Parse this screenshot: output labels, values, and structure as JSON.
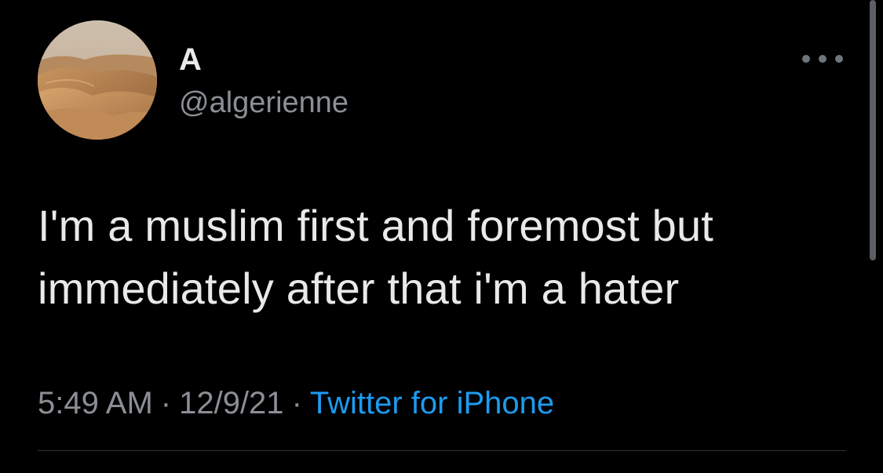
{
  "tweet": {
    "display_name": "A",
    "handle": "@algerienne",
    "text_line1": "I'm a muslim first and foremost but",
    "text_line2": "immediately after that i'm a hater",
    "time": "5:49 AM",
    "date": "12/9/21",
    "source": "Twitter for iPhone",
    "separator": "·"
  },
  "icons": {
    "more": "more-horizontal-icon",
    "avatar": "desert-dunes-avatar"
  },
  "colors": {
    "background": "#000000",
    "primary_text": "#e7e9ea",
    "secondary_text": "#8b8f95",
    "link": "#1d9bf0",
    "divider": "#2f3336"
  }
}
